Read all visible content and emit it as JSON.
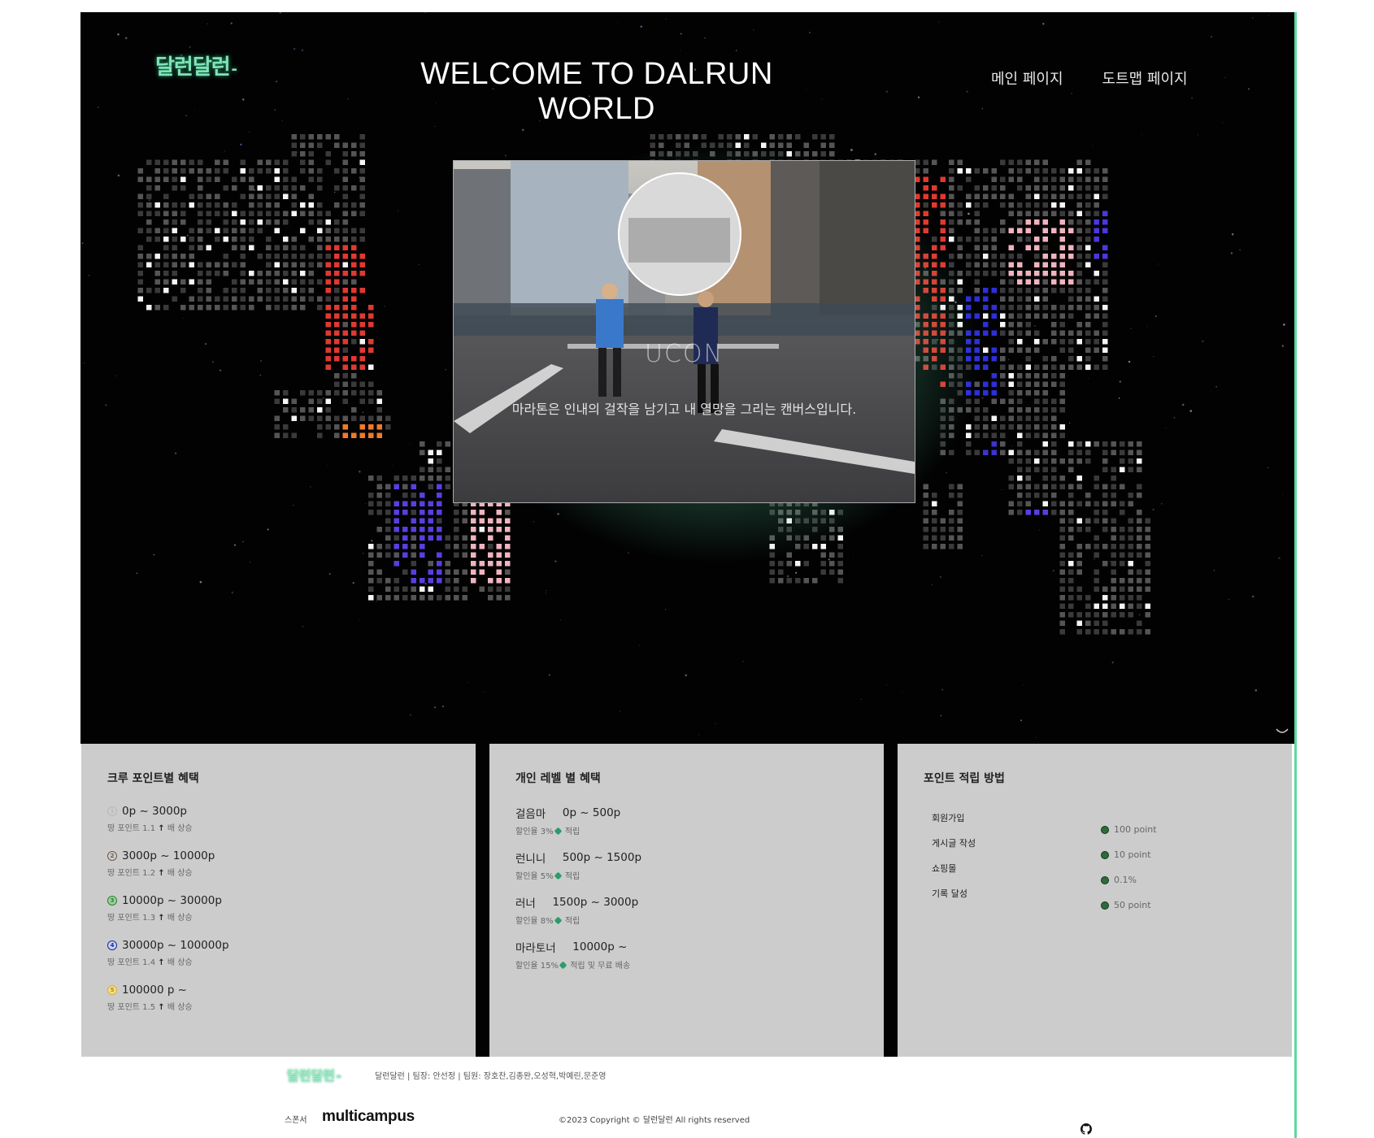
{
  "header": {
    "logo": "달런달런",
    "title": "WELCOME TO DALRUN WORLD",
    "nav": [
      "메인 페이지",
      "도트맵 페이지"
    ]
  },
  "hero": {
    "brand_mark": "UCON",
    "slogan": "마라톤은 인내의 걸작을 남기고 내 열망을 그리는 캔버스입니다.",
    "accent_color": "#5fd6a3"
  },
  "crew_benefits": {
    "title": "크루 포인트별 혜택",
    "items": [
      {
        "tier": "1",
        "range": "0p ~ 3000p",
        "desc_prefix": "땅 포인트 1.1",
        "desc_suffix": "배 상승"
      },
      {
        "tier": "2",
        "range": "3000p ~ 10000p",
        "desc_prefix": "땅 포인트 1.2",
        "desc_suffix": "배 상승"
      },
      {
        "tier": "3",
        "range": "10000p ~ 30000p",
        "desc_prefix": "땅 포인트 1.3",
        "desc_suffix": "배 상승"
      },
      {
        "tier": "4",
        "range": "30000p ~ 100000p",
        "desc_prefix": "땅 포인트 1.4",
        "desc_suffix": "배 상승"
      },
      {
        "tier": "5",
        "range": "100000 p ~",
        "desc_prefix": "땅 포인트 1.5",
        "desc_suffix": "배 상승"
      }
    ]
  },
  "level_benefits": {
    "title": "개인 레벨 별 혜택",
    "items": [
      {
        "name": "걸음마",
        "range": "0p ~ 500p",
        "desc_prefix": "할인율 3%",
        "desc_suffix": "적립"
      },
      {
        "name": "런니니",
        "range": "500p ~ 1500p",
        "desc_prefix": "할인율 5%",
        "desc_suffix": "적립"
      },
      {
        "name": "러너",
        "range": "1500p ~ 3000p",
        "desc_prefix": "할인율 8%",
        "desc_suffix": "적립"
      },
      {
        "name": "마라토너",
        "range": "10000p ~",
        "desc_prefix": "할인율 15%",
        "desc_suffix": "적립 및 무료 배송"
      }
    ]
  },
  "point_methods": {
    "title": "포인트 적립 방법",
    "rows": [
      {
        "label": "회원가입",
        "value": "100 point"
      },
      {
        "label": "게시글 작성",
        "value": "10 point"
      },
      {
        "label": "쇼핑몰",
        "value": "0.1%"
      },
      {
        "label": "기록 달성",
        "value": "50 point"
      }
    ]
  },
  "footer": {
    "logo": "달런달런",
    "team": "달런달런 | 팀장: 안선정 | 팀원: 장호찬,김종완,오성혁,박예린,문준영",
    "sponsor_label": "스폰서",
    "sponsor": "multicampus",
    "copyright": "©2023 Copyright © 달런달런 All rights reserved"
  },
  "icons": {
    "github": "github-icon",
    "scroll": "chevron-down-icon",
    "gem": "gem-icon",
    "arrow": "arrow-up-icon"
  }
}
